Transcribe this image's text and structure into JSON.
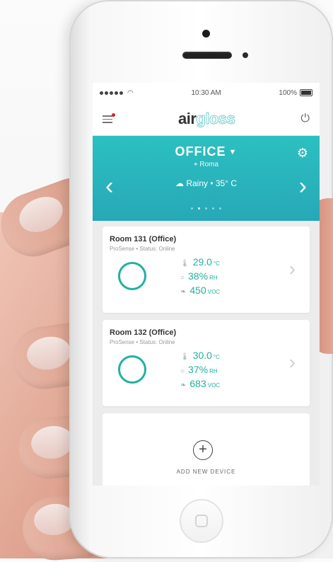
{
  "status_bar": {
    "time": "10:30 AM",
    "battery": "100%"
  },
  "app": {
    "logo_prefix": "air",
    "logo_suffix": "gloss"
  },
  "location": {
    "name": "OFFICE",
    "city": "Roma",
    "weather": "Rainy • 35° C",
    "pager": {
      "count": 5,
      "active": 1
    }
  },
  "devices": [
    {
      "name": "Room 131 (Office)",
      "subtitle": "ProSense • Status: Online",
      "temperature": "29.0",
      "temperature_unit": "°C",
      "humidity": "38%",
      "humidity_unit": "RH",
      "voc": "450",
      "voc_unit": "VOC"
    },
    {
      "name": "Room 132 (Office)",
      "subtitle": "ProSense • Status: Online",
      "temperature": "30.0",
      "temperature_unit": "°C",
      "humidity": "37%",
      "humidity_unit": "RH",
      "voc": "683",
      "voc_unit": "VOC"
    }
  ],
  "add_device": {
    "label": "ADD NEW DEVICE"
  },
  "icons": {
    "menu": "menu-icon",
    "power": "power-icon",
    "settings": "gear-icon",
    "location": "location-pin-icon",
    "weather": "rain-cloud-icon",
    "temperature": "thermometer-icon",
    "humidity": "drop-icon",
    "voc": "leaf-icon"
  },
  "colors": {
    "accent": "#22b19f",
    "header": "#2cc0c0"
  }
}
